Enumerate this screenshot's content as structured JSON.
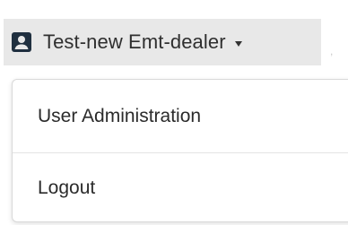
{
  "user_menu": {
    "toggle_label": "Test-new Emt-dealer",
    "icon": "user-badge-icon",
    "caret_icon": "caret-down-icon",
    "trailing_mark": ","
  },
  "dropdown": {
    "items": [
      {
        "label": "User Administration"
      },
      {
        "label": "Logout"
      }
    ]
  },
  "colors": {
    "toggle_background": "#e8e8e8",
    "icon_color": "#1f2f3f",
    "text_color": "#2b2b2b",
    "menu_border": "#d9d9d9"
  }
}
